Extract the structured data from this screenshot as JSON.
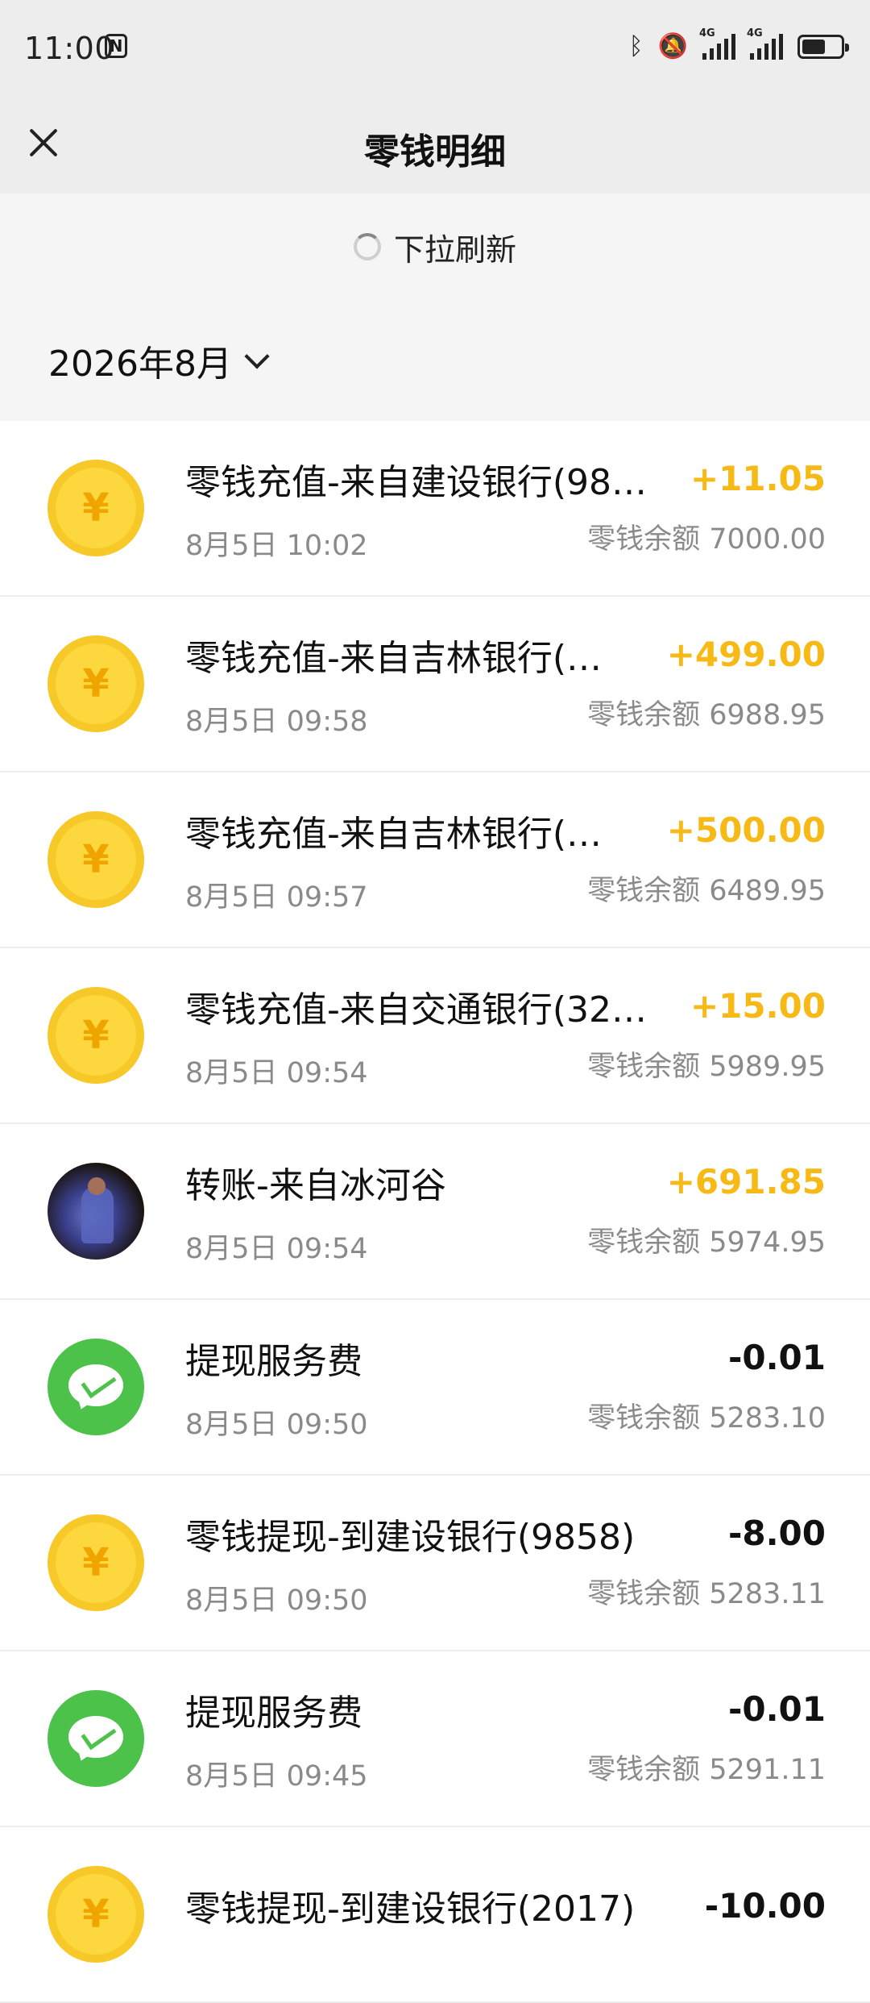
{
  "status_bar": {
    "time": "11:00",
    "signal1": "4G",
    "signal2": "4G"
  },
  "header": {
    "title": "零钱明细"
  },
  "refresh_text": "下拉刷新",
  "month": "2026年8月",
  "colors": {
    "income": "#f6b915",
    "coin": "#f7c928",
    "wechat_green": "#4cc24a"
  },
  "transactions": [
    {
      "icon": "coin-icon",
      "title": "零钱充值-来自建设银行(98…",
      "time": "8月5日 10:02",
      "amount": "+11.05",
      "balance": "零钱余额 7000.00"
    },
    {
      "icon": "coin-icon",
      "title": "零钱充值-来自吉林银行(…",
      "time": "8月5日 09:58",
      "amount": "+499.00",
      "balance": "零钱余额 6988.95"
    },
    {
      "icon": "coin-icon",
      "title": "零钱充值-来自吉林银行(…",
      "time": "8月5日 09:57",
      "amount": "+500.00",
      "balance": "零钱余额 6489.95"
    },
    {
      "icon": "coin-icon",
      "title": "零钱充值-来自交通银行(32…",
      "time": "8月5日 09:54",
      "amount": "+15.00",
      "balance": "零钱余额 5989.95"
    },
    {
      "icon": "user-avatar",
      "title": "转账-来自冰河谷",
      "time": "8月5日 09:54",
      "amount": "+691.85",
      "balance": "零钱余额 5974.95"
    },
    {
      "icon": "wechat-pay-icon",
      "title": "提现服务费",
      "time": "8月5日 09:50",
      "amount": "-0.01",
      "balance": "零钱余额 5283.10"
    },
    {
      "icon": "coin-icon",
      "title": "零钱提现-到建设银行(9858)",
      "time": "8月5日 09:50",
      "amount": "-8.00",
      "balance": "零钱余额 5283.11"
    },
    {
      "icon": "wechat-pay-icon",
      "title": "提现服务费",
      "time": "8月5日 09:45",
      "amount": "-0.01",
      "balance": "零钱余额 5291.11"
    },
    {
      "icon": "coin-icon",
      "title": "零钱提现-到建设银行(2017)",
      "time": "",
      "amount": "-10.00",
      "balance": ""
    }
  ]
}
